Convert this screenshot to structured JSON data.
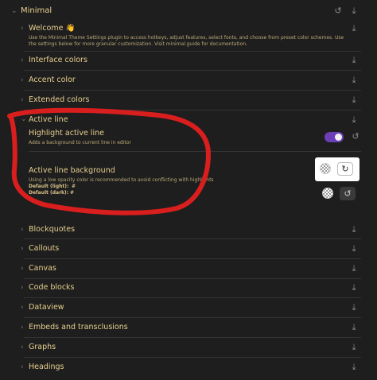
{
  "header": {
    "title": "Minimal"
  },
  "welcome": {
    "label": "Welcome 👋",
    "description": "Use the Minimal Theme Settings plugin to access hotkeys, adjust features, select fonts, and choose from preset color schemes. Use the settings below for more granular customization. Visit minimal.guide for documentation."
  },
  "sections_top": [
    {
      "label": "Interface colors"
    },
    {
      "label": "Accent color"
    },
    {
      "label": "Extended colors"
    }
  ],
  "active_line": {
    "label": "Active line",
    "highlight": {
      "label": "Highlight active line",
      "description": "Adds a background to current line in editor",
      "enabled": true
    },
    "background": {
      "label": "Active line background",
      "description": "Using a low opacity color is recommended to avoid conflicting with highlights",
      "default_light_label": "Default (light):",
      "default_light_value": "#",
      "default_dark_label": "Default (dark):",
      "default_dark_value": "#"
    }
  },
  "sections_bottom": [
    {
      "label": "Blockquotes"
    },
    {
      "label": "Callouts"
    },
    {
      "label": "Canvas"
    },
    {
      "label": "Code blocks"
    },
    {
      "label": "Dataview"
    },
    {
      "label": "Embeds and transclusions"
    },
    {
      "label": "Graphs"
    },
    {
      "label": "Headings"
    }
  ],
  "colors": {
    "annotation_red": "#d91e1e",
    "toggle_on": "#6c3fb8",
    "text": "#e8cf8f"
  }
}
